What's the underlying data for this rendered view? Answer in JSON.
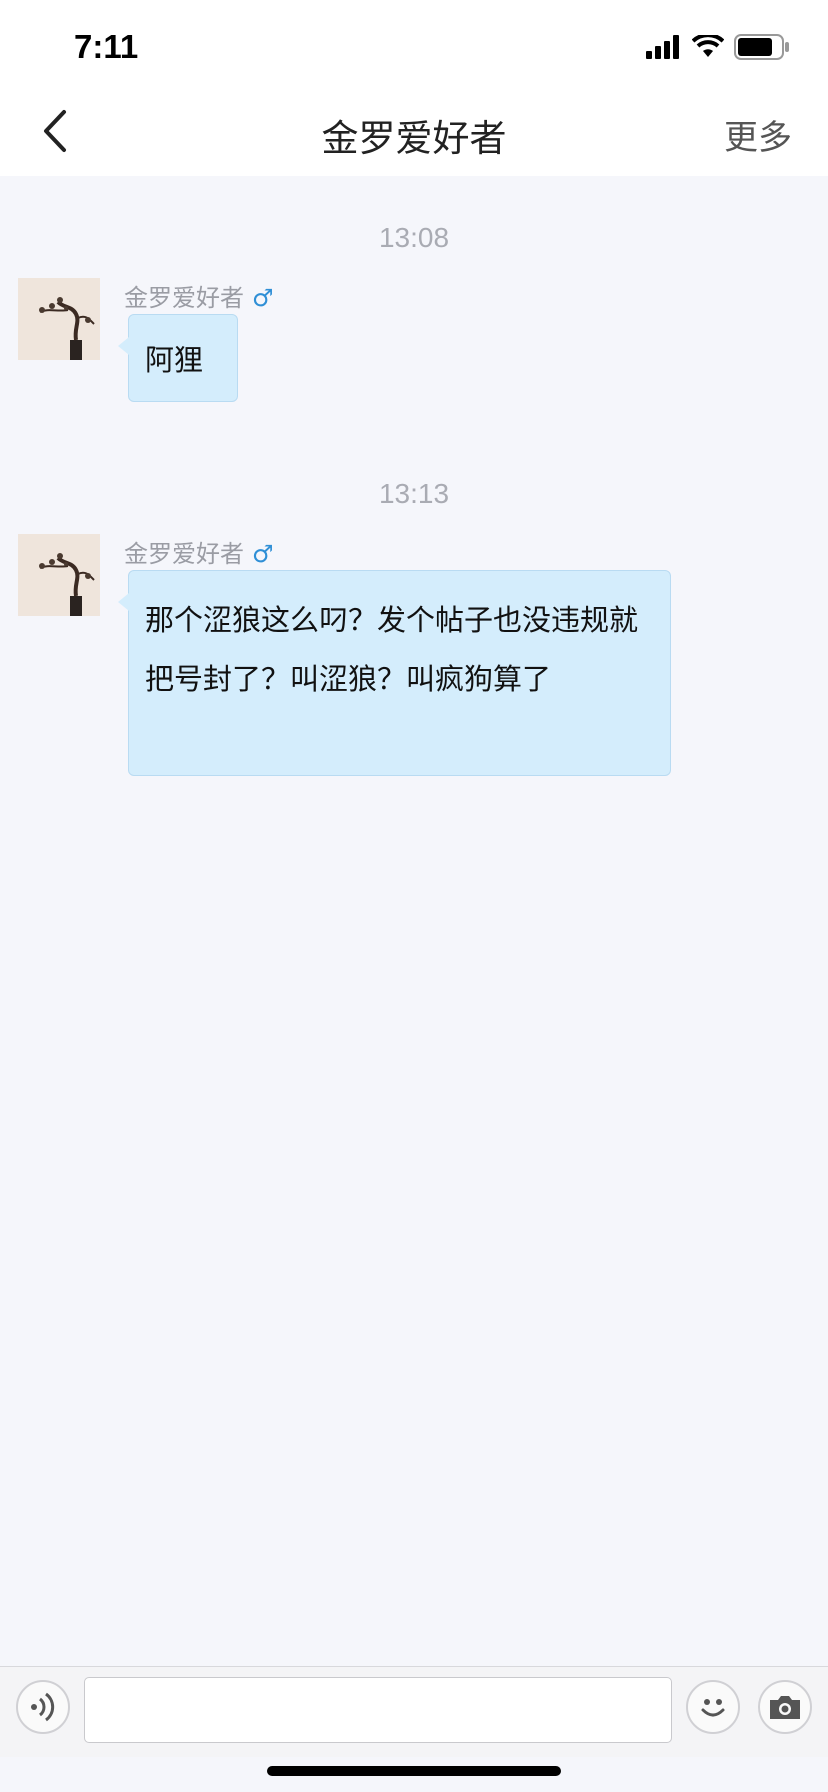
{
  "status": {
    "time": "7:11"
  },
  "nav": {
    "title": "金罗爱好者",
    "more": "更多"
  },
  "messages": [
    {
      "timestamp": "13:08",
      "sender": "金罗爱好者",
      "gender": "♂",
      "text": "阿狸"
    },
    {
      "timestamp": "13:13",
      "sender": "金罗爱好者",
      "gender": "♂",
      "text": "那个涩狼这么叼？发个帖子也没违规就把号封了？叫涩狼？叫疯狗算了"
    }
  ],
  "composer": {
    "value": "",
    "placeholder": ""
  },
  "colors": {
    "bubble": "#d4edfc",
    "background": "#f5f6fb",
    "gender": "#2f8fd6"
  }
}
